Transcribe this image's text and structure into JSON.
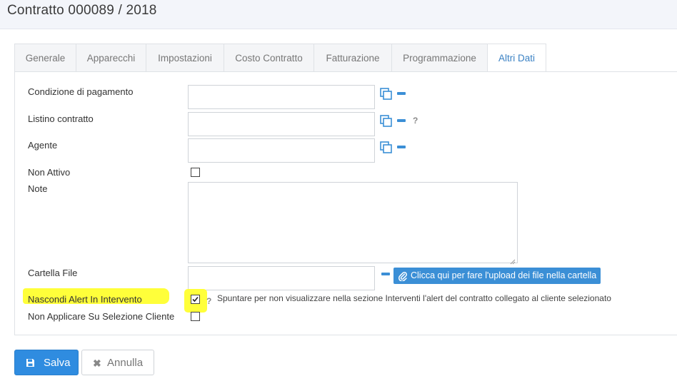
{
  "page": {
    "title": "Contratto 000089 / 2018"
  },
  "tabs": [
    {
      "label": "Generale"
    },
    {
      "label": "Apparecchi"
    },
    {
      "label": "Impostazioni"
    },
    {
      "label": "Costo Contratto"
    },
    {
      "label": "Fatturazione"
    },
    {
      "label": "Programmazione"
    },
    {
      "label": "Altri Dati",
      "active": true
    }
  ],
  "form": {
    "condizione_pagamento": {
      "label": "Condizione di pagamento",
      "value": ""
    },
    "listino_contratto": {
      "label": "Listino contratto",
      "value": "",
      "help": "?"
    },
    "agente": {
      "label": "Agente",
      "value": ""
    },
    "non_attivo": {
      "label": "Non Attivo",
      "checked": false
    },
    "note": {
      "label": "Note",
      "value": ""
    },
    "cartella_file": {
      "label": "Cartella File",
      "value": "",
      "upload_label": "Clicca qui per fare l'upload dei file nella cartella"
    },
    "nascondi_alert": {
      "label": "Nascondi Alert In Intervento",
      "checked": true,
      "help": "?",
      "hint": "Spuntare per non visualizzare nella sezione Interventi l'alert del contratto collegato al cliente selezionato",
      "highlight_color": "#ffff3a"
    },
    "non_applicare": {
      "label": "Non Applicare Su Selezione Cliente",
      "checked": false
    }
  },
  "actions": {
    "save_label": "Salva",
    "cancel_label": "Annulla"
  },
  "colors": {
    "accent": "#3b8fd6",
    "tab_active_text": "#3b82c4"
  }
}
